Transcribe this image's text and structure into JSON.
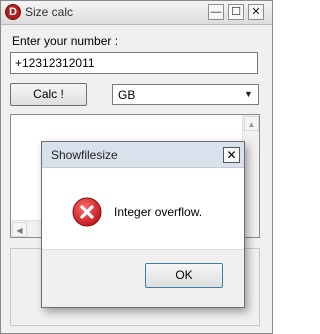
{
  "window": {
    "title": "Size calc",
    "app_icon_letter": "D",
    "minimize_glyph": "—",
    "maximize_glyph": "☐",
    "close_glyph": "✕"
  },
  "form": {
    "input_label": "Enter your number :",
    "input_value": "+12312312011",
    "calc_label": "Calc !",
    "unit_selected": "GB",
    "select_arrow": "▼"
  },
  "scroll": {
    "up_arrow": "▲",
    "left_arrow": "◀"
  },
  "dialog": {
    "title": "Showfilesize",
    "close_glyph": "✕",
    "icon": "error-icon",
    "icon_color": "#d9272e",
    "message": "Integer overflow.",
    "ok_label": "OK"
  }
}
